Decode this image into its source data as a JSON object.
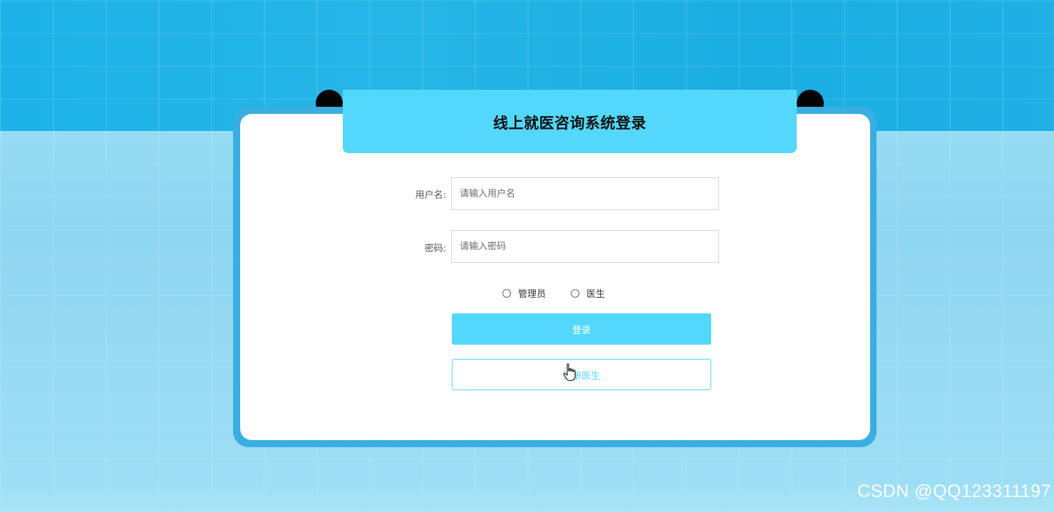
{
  "page": {
    "title": "线上就医咨询系统登录"
  },
  "form": {
    "username": {
      "label": "用户名:",
      "placeholder": "请输入用户名"
    },
    "password": {
      "label": "密码:",
      "placeholder": "请输入密码"
    },
    "roles": [
      {
        "label": "管理员",
        "selected": false
      },
      {
        "label": "医生",
        "selected": false
      }
    ],
    "login_label": "登录",
    "register_label": "注册医生"
  },
  "watermark": "CSDN @QQ123311197",
  "colors": {
    "accent": "#53d8fb",
    "frame": "#3aaee0",
    "background_top": "#1eb3e8",
    "background_bottom": "#9fe2f7"
  },
  "icons": {
    "cursor": "hand-pointer-icon"
  }
}
